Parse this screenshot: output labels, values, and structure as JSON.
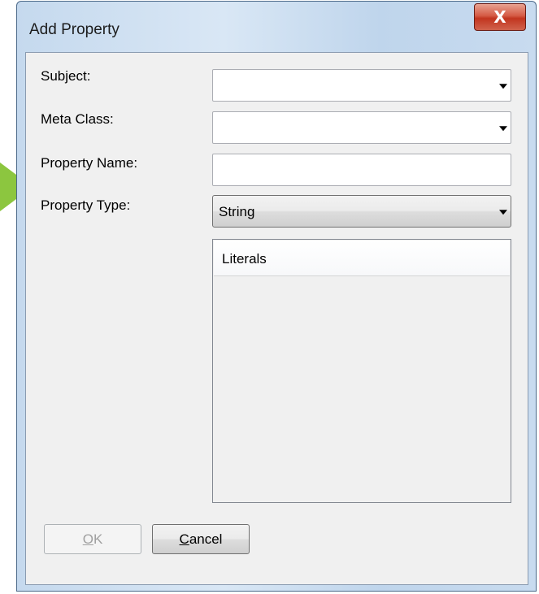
{
  "window": {
    "title": "Add Property",
    "close_glyph": "X"
  },
  "form": {
    "subject_label": "Subject:",
    "subject_value": "",
    "metaclass_label": "Meta Class:",
    "metaclass_value": "",
    "property_name_label": "Property Name:",
    "property_name_value": "",
    "property_type_label": "Property Type:",
    "property_type_value": "String"
  },
  "literals": {
    "header": "Literals",
    "items": []
  },
  "buttons": {
    "ok_mnemonic": "O",
    "ok_rest": "K",
    "cancel_mnemonic": "C",
    "cancel_rest": "ancel"
  },
  "colors": {
    "pointer_arrow": "#8cc63f",
    "close_button": "#c2351f"
  }
}
